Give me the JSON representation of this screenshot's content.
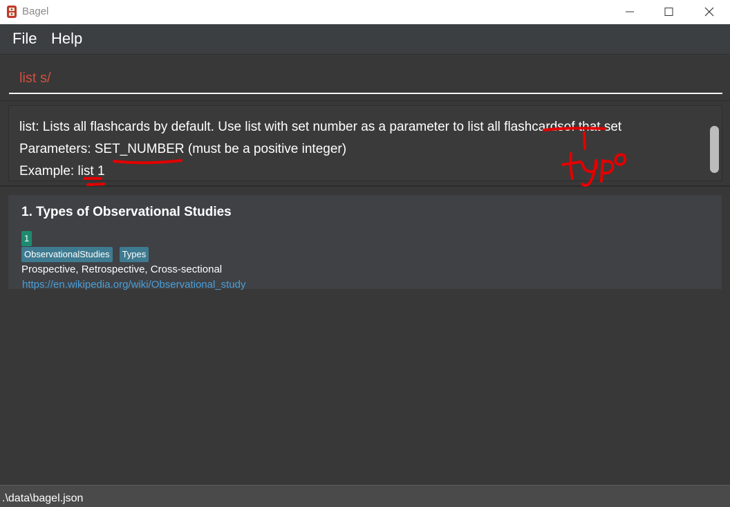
{
  "window": {
    "title": "Bagel",
    "controls": [
      "minimize-icon",
      "maximize-icon",
      "close-icon"
    ]
  },
  "menu": {
    "file": "File",
    "help": "Help"
  },
  "command": {
    "value": "list s/"
  },
  "result": {
    "line1": "list: Lists all flashcards by default. Use list with set number as a parameter to list all flashcardsof that set",
    "line2": "Parameters: SET_NUMBER (must be a positive integer)",
    "line3": "Example: list 1",
    "annotation": "typo"
  },
  "flashcards": [
    {
      "title": "1.  Types of Observational Studies",
      "set": "1",
      "tags": [
        "ObservationalStudies",
        "Types"
      ],
      "answer": "Prospective, Retrospective, Cross-sectional",
      "link": "https://en.wikipedia.org/wiki/Observational_study"
    }
  ],
  "status": {
    "path": ".\\data\\bagel.json"
  },
  "colors": {
    "command_text": "#d24f3f",
    "set_badge": "#1f8a70",
    "tag": "#3e7b91",
    "link": "#4a9fd8",
    "annotation_ink": "#e30000"
  }
}
